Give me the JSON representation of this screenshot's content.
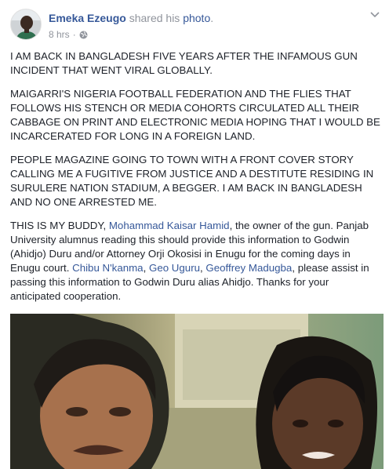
{
  "post": {
    "author": "Emeka Ezeugo",
    "shared_text": "shared his",
    "photo_link": "photo",
    "period": ".",
    "time": "8 hrs",
    "dot": "·",
    "menu_icon": "chevron-down-icon"
  },
  "paragraphs": {
    "p1": "I AM BACK IN BANGLADESH FIVE YEARS AFTER THE INFAMOUS GUN INCIDENT THAT WENT VIRAL GLOBALLY.",
    "p2": "MAIGARRI'S NIGERIA FOOTBALL FEDERATION AND THE FLIES THAT FOLLOWS HIS STENCH OR MEDIA COHORTS CIRCULATED ALL THEIR CABBAGE ON PRINT AND ELECTRONIC MEDIA HOPING THAT I WOULD BE INCARCERATED FOR LONG IN A FOREIGN LAND.",
    "p3": "PEOPLE MAGAZINE GOING TO TOWN WITH A FRONT COVER STORY CALLING ME A FUGITIVE FROM JUSTICE AND A DESTITUTE RESIDING IN SURULERE NATION STADIUM, A BEGGER. I AM BACK IN BANGLADESH AND NO ONE ARRESTED ME.",
    "p4": {
      "t1": "THIS IS MY BUDDY, ",
      "mention1": "Mohammad Kaisar Hamid",
      "t2": ", the owner of the gun. Panjab University alumnus reading this should provide this information to Godwin (Ahidjo) Duru and/or Attorney Orji Okosisi in Enugu for the coming days in Enugu court. ",
      "mention2": "Chibu N'kanma",
      "sep1": ", ",
      "mention3": "Geo Uguru",
      "sep2": ", ",
      "mention4": "Geoffrey Madugba",
      "t3": ", please assist in passing this information to Godwin Duru alias Ahidjo. Thanks for your anticipated cooperation."
    }
  },
  "colors": {
    "link": "#365899",
    "meta": "#90949c",
    "text": "#1d2129"
  }
}
